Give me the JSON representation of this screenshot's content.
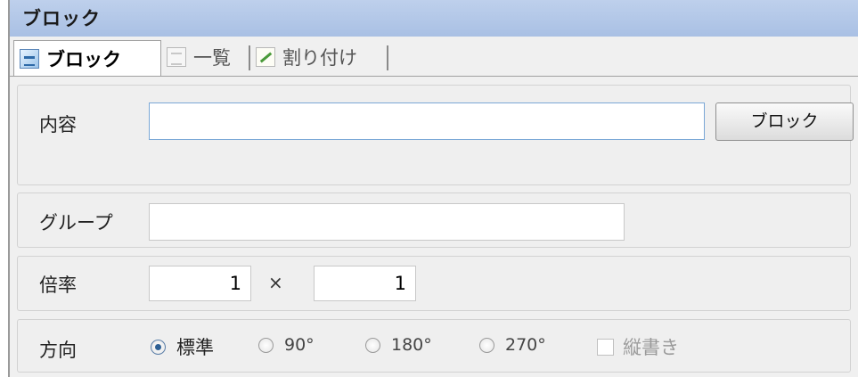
{
  "window": {
    "title": "ブロック"
  },
  "tabs": [
    {
      "label": "ブロック",
      "icon": "block-icon",
      "active": true
    },
    {
      "label": "一覧",
      "icon": "list-icon",
      "active": false
    },
    {
      "label": "割り付け",
      "icon": "assign-icon",
      "active": false
    }
  ],
  "content": {
    "label": "内容",
    "value": "",
    "button_label": "ブロック"
  },
  "group": {
    "label": "グループ",
    "value": ""
  },
  "scale": {
    "label": "倍率",
    "x": "1",
    "separator": "×",
    "y": "1"
  },
  "direction": {
    "label": "方向",
    "options": [
      {
        "label": "標準",
        "checked": true
      },
      {
        "label": "90°",
        "checked": false
      },
      {
        "label": "180°",
        "checked": false
      },
      {
        "label": "270°",
        "checked": false
      }
    ],
    "vertical_label": "縦書き",
    "vertical_checked": false
  }
}
